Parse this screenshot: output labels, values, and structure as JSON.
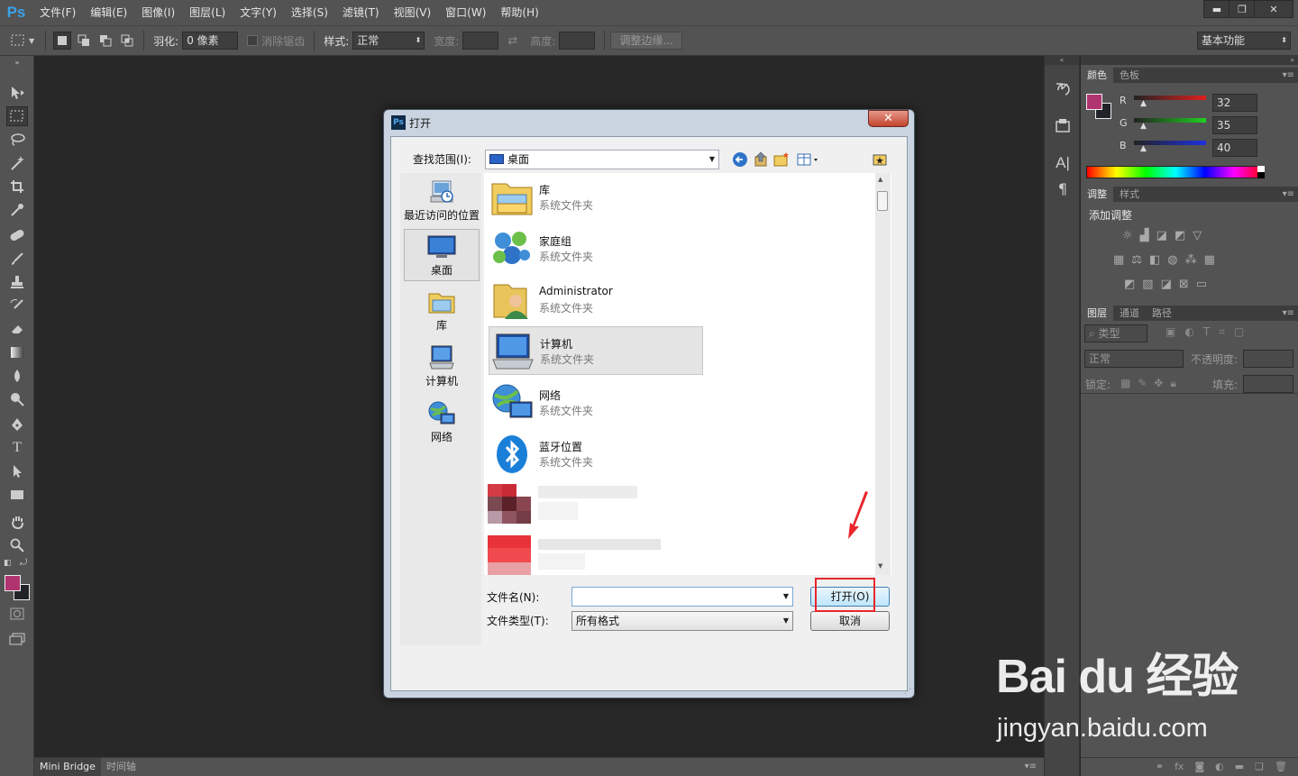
{
  "app": {
    "logo": "Ps",
    "menu": [
      "文件(F)",
      "编辑(E)",
      "图像(I)",
      "图层(L)",
      "文字(Y)",
      "选择(S)",
      "滤镜(T)",
      "视图(V)",
      "窗口(W)",
      "帮助(H)"
    ],
    "window_controls": {
      "minimize": "▬",
      "restore": "❐",
      "close": "✕"
    }
  },
  "options_bar": {
    "feather_label": "羽化:",
    "feather_value": "0 像素",
    "antialias_label": "消除锯齿",
    "style_label": "样式:",
    "style_value": "正常",
    "width_label": "宽度:",
    "height_label": "高度:",
    "refine_edge_button": "调整边缘...",
    "workspace_value": "基本功能"
  },
  "bottom_tabs": [
    "Mini Bridge",
    "时间轴"
  ],
  "panels": {
    "color": {
      "tabs": [
        "颜色",
        "色板"
      ],
      "r_label": "R",
      "r_value": "32",
      "g_label": "G",
      "g_value": "35",
      "b_label": "B",
      "b_value": "40",
      "foreground": "#b03470",
      "background": "#202328"
    },
    "adjust": {
      "tabs": [
        "调整",
        "样式"
      ],
      "heading": "添加调整"
    },
    "layers": {
      "tabs": [
        "图层",
        "通道",
        "路径"
      ],
      "kind_label": "类型",
      "blend_mode": "正常",
      "opacity_label": "不透明度:",
      "lock_label": "锁定:",
      "fill_label": "填充:"
    }
  },
  "dialog": {
    "title": "打开",
    "look_in_label": "查找范围(I):",
    "look_in_value": "桌面",
    "places": [
      "最近访问的位置",
      "桌面",
      "库",
      "计算机",
      "网络"
    ],
    "files": [
      {
        "name": "库",
        "type": "系统文件夹"
      },
      {
        "name": "家庭组",
        "type": "系统文件夹"
      },
      {
        "name": "Administrator",
        "type": "系统文件夹"
      },
      {
        "name": "计算机",
        "type": "系统文件夹"
      },
      {
        "name": "网络",
        "type": "系统文件夹"
      },
      {
        "name": "蓝牙位置",
        "type": "系统文件夹"
      }
    ],
    "filename_label": "文件名(N):",
    "filename_value": "",
    "filetype_label": "文件类型(T):",
    "filetype_value": "所有格式",
    "open_button": "打开(O)",
    "cancel_button": "取消"
  },
  "watermark": {
    "brand": "Bai du 经验",
    "url": "jingyan.baidu.com"
  }
}
